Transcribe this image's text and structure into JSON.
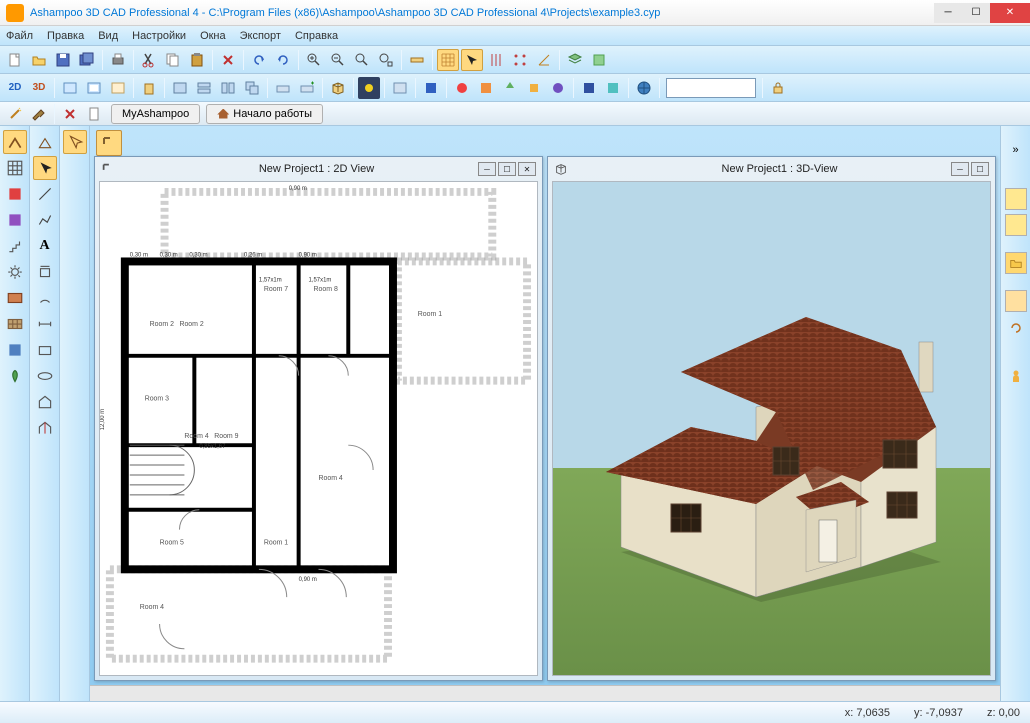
{
  "title": "Ashampoo 3D CAD Professional 4 - C:\\Program Files (x86)\\Ashampoo\\Ashampoo 3D CAD Professional 4\\Projects\\example3.cyp",
  "menu": {
    "file": "Файл",
    "edit": "Правка",
    "view": "Вид",
    "settings": "Настройки",
    "windows": "Окна",
    "export": "Экспорт",
    "help": "Справка"
  },
  "linkbar": {
    "myashampoo": "MyAshampoo",
    "getting_started": "Начало работы"
  },
  "toolbar2": {
    "mode2d": "2D",
    "mode3d": "3D"
  },
  "panel2d": {
    "title": "New Project1 : 2D View"
  },
  "panel3d": {
    "title": "New Project1 : 3D-View"
  },
  "dimensions": {
    "top": "0,90 m",
    "seg030a": "0,30 m",
    "seg030b": "0,30 m",
    "seg030c": "0,30 m",
    "seg026": "0,26 m",
    "seg090": "0,90 m",
    "room7_dim": "1,57x1m",
    "room8_dim": "1,57x1m",
    "left_height": "12,00 m",
    "room9_dim": "0,85x1,67",
    "bottom": "0,90 m"
  },
  "rooms": {
    "r1": "Room 1",
    "r2": "Room 2",
    "r2b": "Room 2",
    "r3": "Room 3",
    "r4": "Room 4",
    "r4b": "Room 4",
    "r4c": "Room 4",
    "r5": "Room 5",
    "r7": "Room 7",
    "r8": "Room 8",
    "r9": "Room 9"
  },
  "status": {
    "x_label": "x:",
    "x_val": "7,0635",
    "y_label": "y:",
    "y_val": "-7,0937",
    "z_label": "z:",
    "z_val": "0,00"
  }
}
